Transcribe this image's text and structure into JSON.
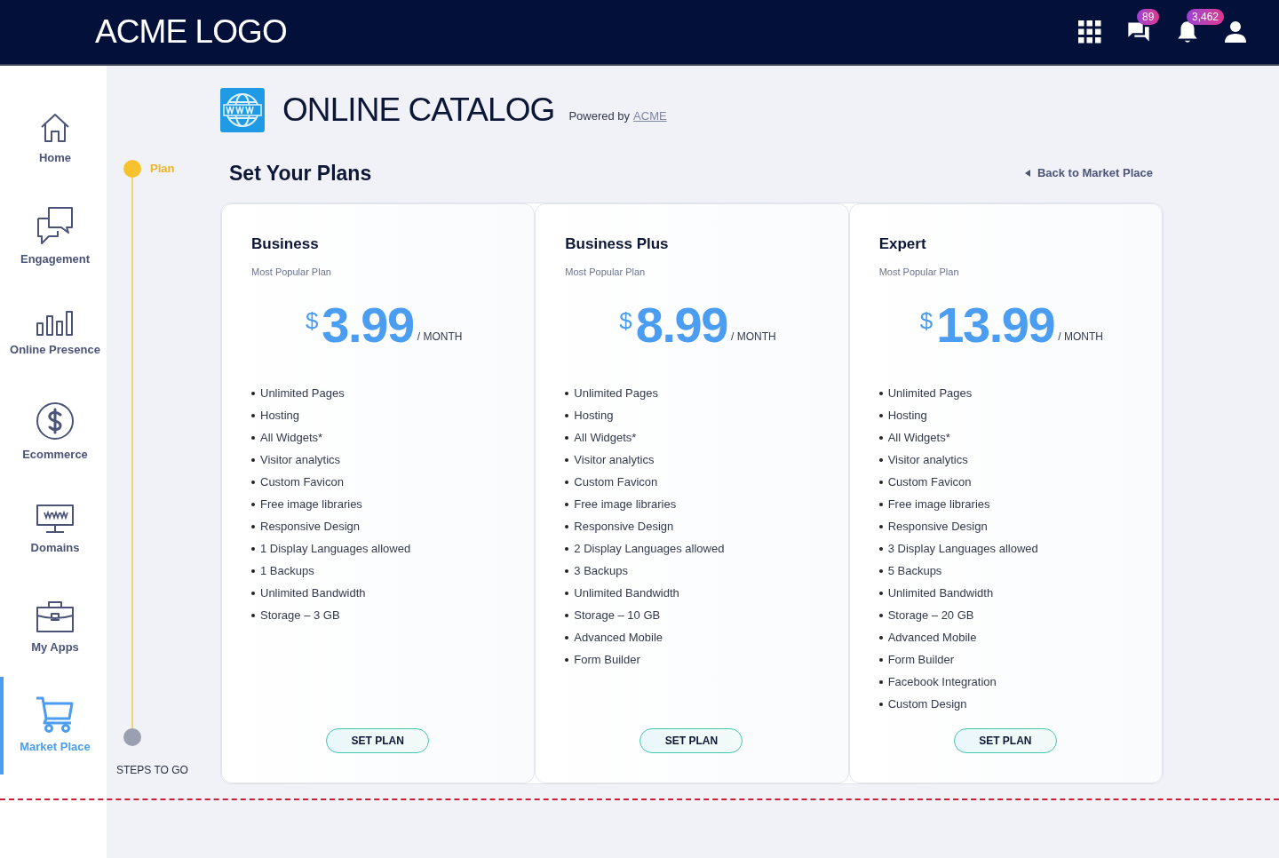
{
  "header": {
    "logo": "ACME LOGO",
    "badges": [
      {
        "kind": "chat",
        "count": "89"
      },
      {
        "kind": "bell",
        "count": "3,462"
      }
    ]
  },
  "sidebar": {
    "items": [
      {
        "kind": "home",
        "label": "Home",
        "selected": false
      },
      {
        "kind": "chat",
        "label": "Engagement",
        "selected": false
      },
      {
        "kind": "bars",
        "label": "Online Presence",
        "selected": false
      },
      {
        "kind": "dollar",
        "label": "Ecommerce",
        "selected": false
      },
      {
        "kind": "www",
        "label": "Domains",
        "selected": false
      },
      {
        "kind": "case",
        "label": "My Apps",
        "selected": false
      },
      {
        "kind": "cart",
        "label": "Market Place",
        "selected": true
      }
    ]
  },
  "steps": {
    "current": "Plan",
    "footer": "STEPS TO GO"
  },
  "catalog": {
    "title": "ONLINE CATALOG",
    "powered": "Powered by",
    "link": "ACME"
  },
  "heading": "Set Your Plans",
  "back": "Back to Market Place",
  "plans": [
    {
      "name": "Business",
      "subtitle": "Most Popular Plan",
      "currency": "$",
      "price": "3.99",
      "period": "/ MONTH",
      "button": "SET PLAN",
      "features": [
        "Unlimited Pages",
        "Hosting",
        "All Widgets*",
        "Visitor analytics",
        "Custom Favicon",
        "Free image libraries",
        "Responsive Design",
        "1 Display Languages allowed",
        "1 Backups",
        "Unlimited Bandwidth",
        "Storage – 3 GB"
      ]
    },
    {
      "name": "Business Plus",
      "subtitle": "Most Popular Plan",
      "currency": "$",
      "price": "8.99",
      "period": "/ MONTH",
      "button": "SET PLAN",
      "features": [
        "Unlimited Pages",
        "Hosting",
        "All Widgets*",
        "Visitor analytics",
        "Custom Favicon",
        "Free image libraries",
        "Responsive Design",
        "2 Display Languages allowed",
        "3 Backups",
        "Unlimited Bandwidth",
        "Storage – 10 GB",
        "Advanced Mobile",
        "Form Builder"
      ]
    },
    {
      "name": "Expert",
      "subtitle": "Most Popular Plan",
      "currency": "$",
      "price": "13.99",
      "period": "/ MONTH",
      "button": "SET PLAN",
      "features": [
        "Unlimited Pages",
        "Hosting",
        "All Widgets*",
        "Visitor analytics",
        "Custom Favicon",
        "Free image libraries",
        "Responsive Design",
        "3 Display Languages allowed",
        "5 Backups",
        "Unlimited Bandwidth",
        "Storage – 20 GB",
        "Advanced Mobile",
        "Form Builder",
        "Facebook Integration",
        "Custom Design"
      ]
    }
  ]
}
